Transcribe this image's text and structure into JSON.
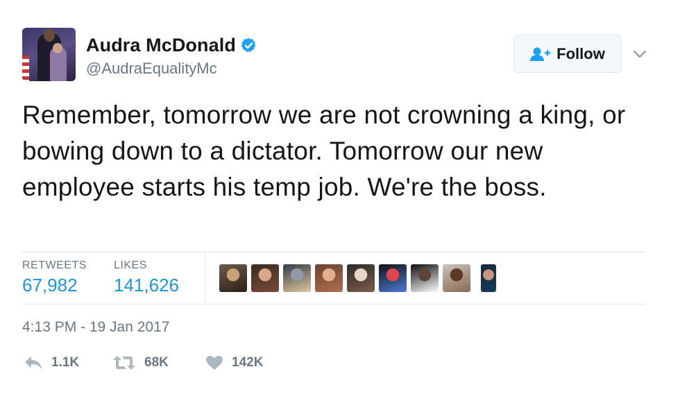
{
  "user": {
    "display_name": "Audra McDonald",
    "handle": "@AudraEqualityMc",
    "verified": true
  },
  "follow_button": {
    "label": "Follow"
  },
  "tweet": {
    "text": "Remember, tomorrow we are not crowning a king, or bowing down to a dictator. Tomorrow our new employee starts his temp job. We're the boss.",
    "timestamp": "4:13 PM - 19 Jan 2017"
  },
  "stats": {
    "retweets_label": "RETWEETS",
    "retweets_value": "67,982",
    "likes_label": "LIKES",
    "likes_value": "141,626"
  },
  "likers": [
    {
      "name": "liker-1",
      "colors": [
        "#6e5a4a",
        "#c9a27c",
        "#2c2118"
      ]
    },
    {
      "name": "liker-2",
      "colors": [
        "#3b2a22",
        "#d9a88c",
        "#7a4a36"
      ]
    },
    {
      "name": "liker-3",
      "colors": [
        "#2f3a45",
        "#8f9aa6",
        "#e2c79d"
      ]
    },
    {
      "name": "liker-4",
      "colors": [
        "#6b4030",
        "#e0b090",
        "#b07050"
      ]
    },
    {
      "name": "liker-5",
      "colors": [
        "#2b2b2b",
        "#e8d5c4",
        "#7b5d4a"
      ]
    },
    {
      "name": "liker-6",
      "colors": [
        "#111111",
        "#e0474c",
        "#4a7bd6"
      ]
    },
    {
      "name": "liker-7",
      "colors": [
        "#0d0d0d",
        "#5a4536",
        "#ffffff"
      ]
    },
    {
      "name": "liker-8",
      "colors": [
        "#c7c3bd",
        "#5a3a26",
        "#8a6a50"
      ]
    },
    {
      "name": "liker-9",
      "colors": [
        "#1a2a3a",
        "#c99478",
        "#0f3d5a"
      ]
    }
  ],
  "actions": {
    "reply_count": "1.1K",
    "retweet_count": "68K",
    "like_count": "142K"
  },
  "colors": {
    "accent": "#1b95e0",
    "verified": "#1da1f2",
    "muted": "#657786",
    "border": "#e1e8ed"
  }
}
